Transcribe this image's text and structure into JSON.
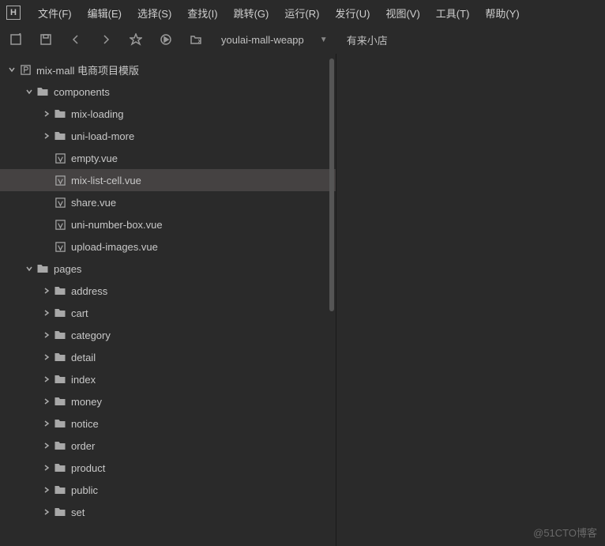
{
  "app_letter": "H",
  "menubar": [
    "文件(F)",
    "编辑(E)",
    "选择(S)",
    "查找(I)",
    "跳转(G)",
    "运行(R)",
    "发行(U)",
    "视图(V)",
    "工具(T)",
    "帮助(Y)"
  ],
  "toolbar": {
    "project_name": "youlai-mall-weapp",
    "project_label": "有来小店"
  },
  "tree": [
    {
      "depth": 0,
      "expand": true,
      "kind": "project",
      "label": "mix-mall 电商项目模版",
      "selected": false
    },
    {
      "depth": 1,
      "expand": true,
      "kind": "folder",
      "label": "components",
      "selected": false
    },
    {
      "depth": 2,
      "expand": false,
      "kind": "folder",
      "label": "mix-loading",
      "selected": false
    },
    {
      "depth": 2,
      "expand": false,
      "kind": "folder",
      "label": "uni-load-more",
      "selected": false
    },
    {
      "depth": 2,
      "expand": null,
      "kind": "vue",
      "label": "empty.vue",
      "selected": false
    },
    {
      "depth": 2,
      "expand": null,
      "kind": "vue",
      "label": "mix-list-cell.vue",
      "selected": true
    },
    {
      "depth": 2,
      "expand": null,
      "kind": "vue",
      "label": "share.vue",
      "selected": false
    },
    {
      "depth": 2,
      "expand": null,
      "kind": "vue",
      "label": "uni-number-box.vue",
      "selected": false
    },
    {
      "depth": 2,
      "expand": null,
      "kind": "vue",
      "label": "upload-images.vue",
      "selected": false
    },
    {
      "depth": 1,
      "expand": true,
      "kind": "folder",
      "label": "pages",
      "selected": false
    },
    {
      "depth": 2,
      "expand": false,
      "kind": "folder",
      "label": "address",
      "selected": false
    },
    {
      "depth": 2,
      "expand": false,
      "kind": "folder",
      "label": "cart",
      "selected": false
    },
    {
      "depth": 2,
      "expand": false,
      "kind": "folder",
      "label": "category",
      "selected": false
    },
    {
      "depth": 2,
      "expand": false,
      "kind": "folder",
      "label": "detail",
      "selected": false
    },
    {
      "depth": 2,
      "expand": false,
      "kind": "folder",
      "label": "index",
      "selected": false
    },
    {
      "depth": 2,
      "expand": false,
      "kind": "folder",
      "label": "money",
      "selected": false
    },
    {
      "depth": 2,
      "expand": false,
      "kind": "folder",
      "label": "notice",
      "selected": false
    },
    {
      "depth": 2,
      "expand": false,
      "kind": "folder",
      "label": "order",
      "selected": false
    },
    {
      "depth": 2,
      "expand": false,
      "kind": "folder",
      "label": "product",
      "selected": false
    },
    {
      "depth": 2,
      "expand": false,
      "kind": "folder",
      "label": "public",
      "selected": false
    },
    {
      "depth": 2,
      "expand": false,
      "kind": "folder",
      "label": "set",
      "selected": false
    }
  ],
  "watermark": "@51CTO博客"
}
